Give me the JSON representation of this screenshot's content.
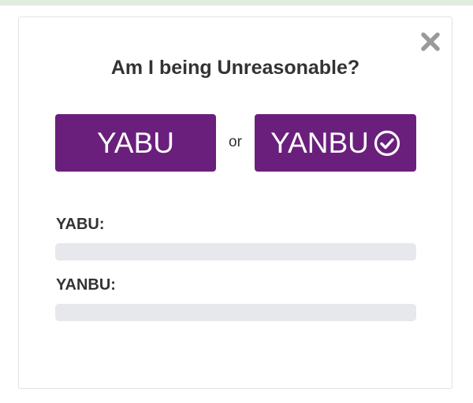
{
  "modal": {
    "title": "Am I being Unreasonable?",
    "close_icon": "close-icon",
    "accent_color": "#6b1f7c"
  },
  "vote": {
    "yabu_label": "YABU",
    "separator": "or",
    "yanbu_label": "YANBU",
    "yanbu_icon": "check-circle-icon"
  },
  "results": {
    "yabu_label": "YABU:",
    "yabu_fraction": 0,
    "yanbu_label": "YANBU:",
    "yanbu_fraction": 0
  }
}
